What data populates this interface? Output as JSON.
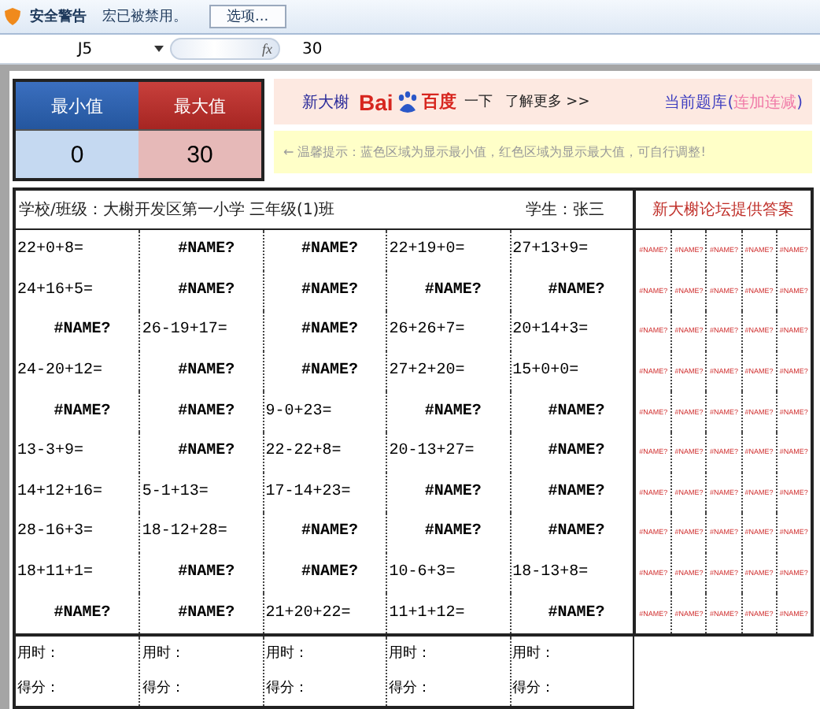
{
  "security_bar": {
    "title": "安全警告",
    "message": "宏已被禁用。",
    "button": "选项..."
  },
  "formula_bar": {
    "cell": "J5",
    "fx": "fx",
    "value": "30"
  },
  "range": {
    "min_label": "最小值",
    "max_label": "最大值",
    "min_value": "0",
    "max_value": "30"
  },
  "banner": {
    "brand": "新大榭",
    "logo_left": "Bai",
    "logo_right": "百度",
    "search": "一下",
    "more": "了解更多 >>",
    "bank_label": "当前题库(",
    "bank_name": "连加连减",
    "bank_close": ")",
    "tip": "← 温馨提示：蓝色区域为显示最小值，红色区域为显示最大值，可自行调整!"
  },
  "sheet": {
    "school": "学校/班级：大榭开发区第一小学 三年级(1)班",
    "student": "学生：张三",
    "answers_title": "新大榭论坛提供答案",
    "rows": [
      [
        {
          "kind": "question",
          "text": "22+0+8="
        },
        {
          "kind": "error",
          "text": "#NAME?"
        },
        {
          "kind": "error",
          "text": "#NAME?"
        },
        {
          "kind": "question",
          "text": "22+19+0="
        },
        {
          "kind": "question",
          "text": "27+13+9="
        }
      ],
      [
        {
          "kind": "question",
          "text": "24+16+5="
        },
        {
          "kind": "error",
          "text": "#NAME?"
        },
        {
          "kind": "error",
          "text": "#NAME?"
        },
        {
          "kind": "error",
          "text": "#NAME?"
        },
        {
          "kind": "error",
          "text": "#NAME?"
        }
      ],
      [
        {
          "kind": "error",
          "text": "#NAME?"
        },
        {
          "kind": "question",
          "text": "26-19+17="
        },
        {
          "kind": "error",
          "text": "#NAME?"
        },
        {
          "kind": "question",
          "text": "26+26+7="
        },
        {
          "kind": "question",
          "text": "20+14+3="
        }
      ],
      [
        {
          "kind": "question",
          "text": "24-20+12="
        },
        {
          "kind": "error",
          "text": "#NAME?"
        },
        {
          "kind": "error",
          "text": "#NAME?"
        },
        {
          "kind": "question",
          "text": "27+2+20="
        },
        {
          "kind": "question",
          "text": "15+0+0="
        }
      ],
      [
        {
          "kind": "error",
          "text": "#NAME?"
        },
        {
          "kind": "error",
          "text": "#NAME?"
        },
        {
          "kind": "question",
          "text": "9-0+23="
        },
        {
          "kind": "error",
          "text": "#NAME?"
        },
        {
          "kind": "error",
          "text": "#NAME?"
        }
      ],
      [
        {
          "kind": "question",
          "text": "13-3+9="
        },
        {
          "kind": "error",
          "text": "#NAME?"
        },
        {
          "kind": "question",
          "text": "22-22+8="
        },
        {
          "kind": "question",
          "text": "20-13+27="
        },
        {
          "kind": "error",
          "text": "#NAME?"
        }
      ],
      [
        {
          "kind": "question",
          "text": "14+12+16="
        },
        {
          "kind": "question",
          "text": "5-1+13="
        },
        {
          "kind": "question",
          "text": "17-14+23="
        },
        {
          "kind": "error",
          "text": "#NAME?"
        },
        {
          "kind": "error",
          "text": "#NAME?"
        }
      ],
      [
        {
          "kind": "question",
          "text": "28-16+3="
        },
        {
          "kind": "question",
          "text": "18-12+28="
        },
        {
          "kind": "error",
          "text": "#NAME?"
        },
        {
          "kind": "error",
          "text": "#NAME?"
        },
        {
          "kind": "error",
          "text": "#NAME?"
        }
      ],
      [
        {
          "kind": "question",
          "text": "18+11+1="
        },
        {
          "kind": "error",
          "text": "#NAME?"
        },
        {
          "kind": "error",
          "text": "#NAME?"
        },
        {
          "kind": "question",
          "text": "10-6+3="
        },
        {
          "kind": "question",
          "text": "18-13+8="
        }
      ],
      [
        {
          "kind": "error",
          "text": "#NAME?"
        },
        {
          "kind": "error",
          "text": "#NAME?"
        },
        {
          "kind": "question",
          "text": "21+20+22="
        },
        {
          "kind": "question",
          "text": "11+1+12="
        },
        {
          "kind": "error",
          "text": "#NAME?"
        }
      ]
    ],
    "answers": [
      [
        "#NAME?",
        "#NAME?",
        "#NAME?",
        "#NAME?",
        "#NAME?"
      ],
      [
        "#NAME?",
        "#NAME?",
        "#NAME?",
        "#NAME?",
        "#NAME?"
      ],
      [
        "#NAME?",
        "#NAME?",
        "#NAME?",
        "#NAME?",
        "#NAME?"
      ],
      [
        "#NAME?",
        "#NAME?",
        "#NAME?",
        "#NAME?",
        "#NAME?"
      ],
      [
        "#NAME?",
        "#NAME?",
        "#NAME?",
        "#NAME?",
        "#NAME?"
      ],
      [
        "#NAME?",
        "#NAME?",
        "#NAME?",
        "#NAME?",
        "#NAME?"
      ],
      [
        "#NAME?",
        "#NAME?",
        "#NAME?",
        "#NAME?",
        "#NAME?"
      ],
      [
        "#NAME?",
        "#NAME?",
        "#NAME?",
        "#NAME?",
        "#NAME?"
      ],
      [
        "#NAME?",
        "#NAME?",
        "#NAME?",
        "#NAME?",
        "#NAME?"
      ],
      [
        "#NAME?",
        "#NAME?",
        "#NAME?",
        "#NAME?",
        "#NAME?"
      ]
    ],
    "footer": [
      {
        "time": "用时：",
        "score": "得分："
      },
      {
        "time": "用时：",
        "score": "得分："
      },
      {
        "time": "用时：",
        "score": "得分："
      },
      {
        "time": "用时：",
        "score": "得分："
      },
      {
        "time": "用时：",
        "score": "得分："
      }
    ]
  }
}
